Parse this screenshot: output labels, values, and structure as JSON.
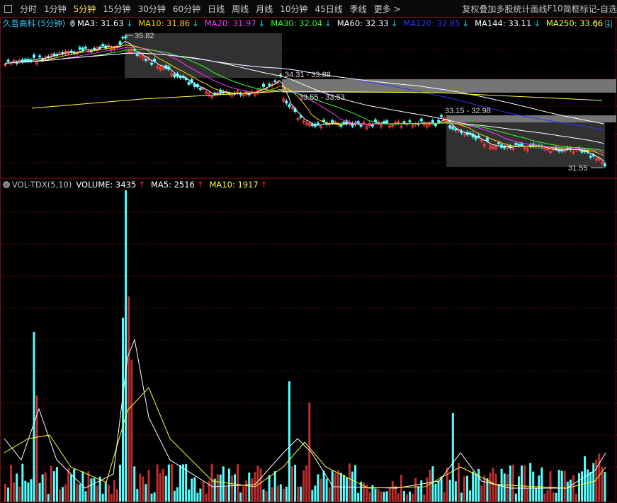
{
  "toolbar": {
    "periods": [
      "分时",
      "1分钟",
      "5分钟",
      "15分钟",
      "30分钟",
      "60分钟",
      "日线",
      "周线",
      "月线",
      "10分钟",
      "45日线",
      "季线",
      "更多 >"
    ],
    "active_period": "5分钟",
    "tools": [
      "复权",
      "叠加",
      "多股",
      "统计",
      "画线",
      "F10",
      "简框",
      "标记",
      "-自选"
    ]
  },
  "stock": {
    "name": "久吾高科",
    "period": "(5分钟)"
  },
  "ma_legend": [
    {
      "label": "MA3: 31.63",
      "color": "#ffffff",
      "arrow": "↓",
      "arrow_color": "#00e5ff"
    },
    {
      "label": "MA10: 31.86",
      "color": "#ffd700",
      "arrow": "↓",
      "arrow_color": "#00e5ff"
    },
    {
      "label": "MA20: 31.97",
      "color": "#ff33ff",
      "arrow": "↓",
      "arrow_color": "#00e5ff"
    },
    {
      "label": "MA30: 32.04",
      "color": "#33ff33",
      "arrow": "↓",
      "arrow_color": "#00e5ff"
    },
    {
      "label": "MA60: 32.33",
      "color": "#ffffff",
      "arrow": "↓",
      "arrow_color": "#00e5ff"
    },
    {
      "label": "MA120: 32.85",
      "color": "#3333ff",
      "arrow": "↓",
      "arrow_color": "#00e5ff"
    },
    {
      "label": "MA144: 33.11",
      "color": "#ffffff",
      "arrow": "↓",
      "arrow_color": "#00e5ff"
    },
    {
      "label": "MA250: 33.66",
      "color": "#ffff33",
      "arrow": "↓",
      "arrow_color": "#00e5ff"
    }
  ],
  "vol_legend": [
    {
      "label": "VOL-TDX(5,10)",
      "color": "#c0c0c0",
      "arrow": "",
      "arrow_color": ""
    },
    {
      "label": "VOLUME: 3435",
      "color": "#ffffff",
      "arrow": "↑",
      "arrow_color": "#ff3333"
    },
    {
      "label": "MA5: 2516",
      "color": "#ffffff",
      "arrow": "↑",
      "arrow_color": "#ff3333"
    },
    {
      "label": "MA10: 1917",
      "color": "#ffff33",
      "arrow": "↑",
      "arrow_color": "#ff3333"
    }
  ],
  "annotations": {
    "high": "35.82",
    "range1": "34.31 - 33.88",
    "range2": "33.55 - 33.53",
    "range3": "33.15 - 32.98",
    "low": "31.55"
  },
  "icons": {
    "collapse": "collapse-circle-icon",
    "diamond": "diamond-icon",
    "square": "window-square-icon"
  }
}
